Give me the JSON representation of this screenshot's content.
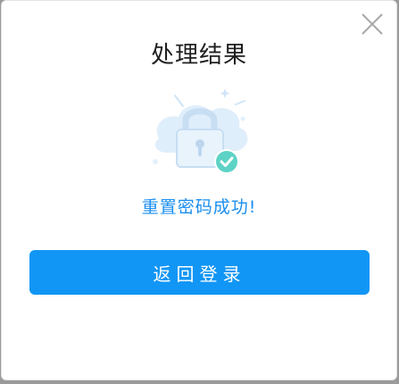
{
  "dialog": {
    "title": "处理结果",
    "status_message": "重置密码成功!",
    "primary_button_label": "返回登录",
    "close_icon": "close-icon",
    "illustration_icon": "lock-success-icon"
  },
  "colors": {
    "accent": "#1296f5",
    "status_text": "#1a8ef0",
    "check_badge": "#5dd3c5",
    "illustration_light": "#d9ecfb"
  }
}
